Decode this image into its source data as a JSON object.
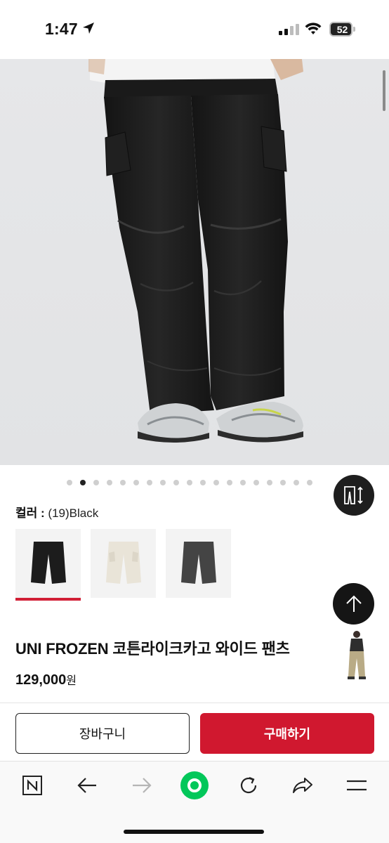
{
  "status_bar": {
    "time": "1:47",
    "battery": "52"
  },
  "gallery": {
    "slide_count": 19,
    "active_index": 1
  },
  "product": {
    "color_label": "컬러 :",
    "color_value": "(19)Black",
    "swatches": [
      {
        "name": "black",
        "color": "#1c1c1c"
      },
      {
        "name": "cream",
        "color": "#e9e4d8"
      },
      {
        "name": "charcoal",
        "color": "#444444"
      }
    ],
    "selected_swatch": 0,
    "title": "UNI FROZEN 코튼라이크카고 와이드 팬츠",
    "price": "129,000",
    "price_unit": "원"
  },
  "actions": {
    "cart_label": "장바구니",
    "buy_label": "구매하기"
  },
  "colors": {
    "accent": "#d0182f",
    "fab_bg": "#1e1e1e",
    "naver_green": "#03c75a"
  },
  "browser_nav": {
    "icons": [
      "naver-n-icon",
      "back-arrow-icon",
      "forward-arrow-icon",
      "home-circle-icon",
      "refresh-icon",
      "share-icon",
      "menu-icon"
    ]
  }
}
